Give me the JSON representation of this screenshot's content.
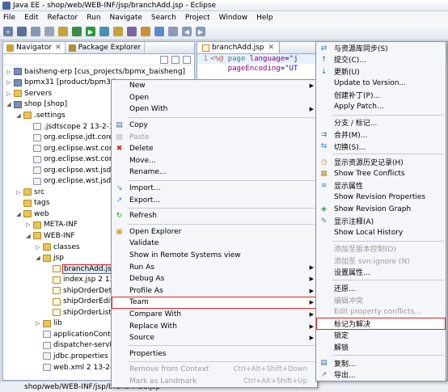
{
  "window": {
    "title": "Java EE - shop/web/WEB-INF/jsp/branchAdd.jsp - Eclipse"
  },
  "menubar": [
    "File",
    "Edit",
    "Refactor",
    "Run",
    "Navigate",
    "Search",
    "Project",
    "Window",
    "Help"
  ],
  "navigator": {
    "tab_navigator": "Navigator",
    "tab_package_explorer": "Package Explorer",
    "tree": [
      {
        "label": "baisheng-erp [cus_projects/bpmx_baisheng]",
        "indent": 0,
        "twisty": "▷",
        "icon": "project"
      },
      {
        "label": "bpmx31 [product/bpm3/bp",
        "indent": 0,
        "twisty": "▷",
        "icon": "project"
      },
      {
        "label": "Servers",
        "indent": 0,
        "twisty": "▷",
        "icon": "folder"
      },
      {
        "label": "shop [shop]",
        "indent": 0,
        "twisty": "◢",
        "icon": "project"
      },
      {
        "label": ".settings",
        "indent": 1,
        "twisty": "◢",
        "icon": "folder"
      },
      {
        "label": ".jsdtscope 2  13-2-19",
        "indent": 2,
        "twisty": "",
        "icon": "file"
      },
      {
        "label": "org.eclipse.jdt.core.",
        "indent": 2,
        "twisty": "",
        "icon": "file"
      },
      {
        "label": "org.eclipse.wst.comn",
        "indent": 2,
        "twisty": "",
        "icon": "file"
      },
      {
        "label": "org.eclipse.wst.comn",
        "indent": 2,
        "twisty": "",
        "icon": "file"
      },
      {
        "label": "org.eclipse.wst.jsdt.u",
        "indent": 2,
        "twisty": "",
        "icon": "file"
      },
      {
        "label": "org.eclipse.wst.jsdt.u",
        "indent": 2,
        "twisty": "",
        "icon": "file"
      },
      {
        "label": "src",
        "indent": 1,
        "twisty": "▷",
        "icon": "folder"
      },
      {
        "label": "tags",
        "indent": 1,
        "twisty": "",
        "icon": "folder"
      },
      {
        "label": "web",
        "indent": 1,
        "twisty": "◢",
        "icon": "folder"
      },
      {
        "label": "META-INF",
        "indent": 2,
        "twisty": "▷",
        "icon": "folder"
      },
      {
        "label": "WEB-INF",
        "indent": 2,
        "twisty": "◢",
        "icon": "folder"
      },
      {
        "label": "classes",
        "indent": 3,
        "twisty": "▷",
        "icon": "folder"
      },
      {
        "label": "jsp",
        "indent": 3,
        "twisty": "◢",
        "icon": "folder"
      },
      {
        "label": "branchAdd.jsp",
        "indent": 4,
        "twisty": "",
        "icon": "jsp",
        "selected": true
      },
      {
        "label": "index.jsp 2  13",
        "indent": 4,
        "twisty": "",
        "icon": "jsp"
      },
      {
        "label": "shipOrderDeta",
        "indent": 4,
        "twisty": "",
        "icon": "jsp"
      },
      {
        "label": "shipOrderEdit",
        "indent": 4,
        "twisty": "",
        "icon": "jsp"
      },
      {
        "label": "shipOrderList.",
        "indent": 4,
        "twisty": "",
        "icon": "jsp"
      },
      {
        "label": "lib",
        "indent": 3,
        "twisty": "▷",
        "icon": "folder"
      },
      {
        "label": "applicationConte",
        "indent": 3,
        "twisty": "",
        "icon": "file"
      },
      {
        "label": "dispatcher-servle",
        "indent": 3,
        "twisty": "",
        "icon": "file"
      },
      {
        "label": "jdbc.properties 2",
        "indent": 3,
        "twisty": "",
        "icon": "file"
      },
      {
        "label": "web.xml 2  13-2-",
        "indent": 3,
        "twisty": "",
        "icon": "file"
      }
    ]
  },
  "editor": {
    "tab": "branchAdd.jsp",
    "lines": [
      {
        "n": "1",
        "parts": [
          [
            "dl",
            "<%@ "
          ],
          [
            "kw",
            "page "
          ],
          [
            "at",
            "language"
          ],
          [
            "",
            "="
          ],
          [
            "st",
            "\"j"
          ]
        ]
      },
      {
        "n": "",
        "parts": [
          [
            "",
            ""
          ],
          [
            "at",
            "    pageEncoding"
          ],
          [
            "",
            "="
          ],
          [
            "st",
            "\"UT"
          ]
        ]
      },
      {
        "n": "",
        "parts": [
          [
            "",
            ""
          ]
        ]
      }
    ]
  },
  "status": {
    "path": "shop/web/WEB-INF/jsp/branchAdd.jsp"
  },
  "context_menu": [
    {
      "label": "New",
      "arrow": true
    },
    {
      "label": "Open"
    },
    {
      "label": "Open With",
      "arrow": true
    },
    {
      "sep": true
    },
    {
      "label": "Copy",
      "icon": "copy"
    },
    {
      "label": "Paste",
      "icon": "paste",
      "disabled": true
    },
    {
      "label": "Delete",
      "icon": "delete"
    },
    {
      "label": "Move..."
    },
    {
      "label": "Rename..."
    },
    {
      "sep": true
    },
    {
      "label": "Import...",
      "icon": "import"
    },
    {
      "label": "Export...",
      "icon": "export"
    },
    {
      "sep": true
    },
    {
      "label": "Refresh",
      "icon": "refresh"
    },
    {
      "sep": true
    },
    {
      "label": "Open Explorer",
      "icon": "explorer"
    },
    {
      "label": "Validate"
    },
    {
      "label": "Show in Remote Systems view"
    },
    {
      "label": "Run As",
      "arrow": true
    },
    {
      "label": "Debug As",
      "arrow": true
    },
    {
      "label": "Profile As",
      "arrow": true
    },
    {
      "label": "Team",
      "arrow": true,
      "highlight": true
    },
    {
      "label": "Compare With",
      "arrow": true
    },
    {
      "label": "Replace With",
      "arrow": true
    },
    {
      "label": "Source",
      "arrow": true
    },
    {
      "sep": true
    },
    {
      "label": "Properties"
    },
    {
      "sep": true
    },
    {
      "label": "Remove from Context",
      "accel": "Ctrl+Alt+Shift+Down",
      "disabled": true
    },
    {
      "label": "Mark as Landmark",
      "accel": "Ctrl+Alt+Shift+Up",
      "disabled": true
    }
  ],
  "team_menu": [
    {
      "label": "与资源库同步(S)",
      "icon": "sync"
    },
    {
      "label": "提交(C)...",
      "icon": "commit"
    },
    {
      "label": "更新(U)",
      "icon": "update"
    },
    {
      "label": "Update to Version..."
    },
    {
      "label": "创建补丁(P)..."
    },
    {
      "label": "Apply Patch..."
    },
    {
      "sep": true
    },
    {
      "label": "分支 / 标记..."
    },
    {
      "label": "合并(M)...",
      "icon": "merge"
    },
    {
      "label": "切换(S)...",
      "icon": "switch"
    },
    {
      "sep": true
    },
    {
      "label": "显示资源历史记录(H)",
      "icon": "history"
    },
    {
      "label": "Show Tree Conflicts",
      "icon": "conflicts"
    },
    {
      "label": "显示属性",
      "icon": "props"
    },
    {
      "label": "Show Revision Properties"
    },
    {
      "label": "Show Revision Graph",
      "icon": "graph"
    },
    {
      "label": "显示注释(A)",
      "icon": "annotate"
    },
    {
      "label": "Show Local History"
    },
    {
      "sep": true
    },
    {
      "label": "添加至版本控制(D)",
      "disabled": true
    },
    {
      "label": "添加至 svn:ignore (N)",
      "disabled": true
    },
    {
      "label": "设置属性..."
    },
    {
      "sep": true
    },
    {
      "label": "还原..."
    },
    {
      "label": "编辑冲突",
      "disabled": true
    },
    {
      "label": "Edit property conflicts...",
      "disabled": true
    },
    {
      "label": "标记为解决",
      "highlight": true
    },
    {
      "label": "锁定"
    },
    {
      "label": "解锁"
    },
    {
      "sep": true
    },
    {
      "label": "复制...",
      "icon": "copy2"
    },
    {
      "label": "导出...",
      "icon": "export2"
    }
  ]
}
